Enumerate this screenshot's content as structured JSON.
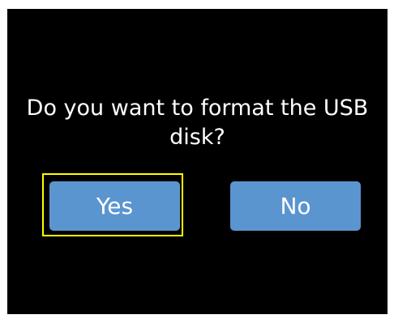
{
  "dialog": {
    "message": "Do you want to format the USB disk?",
    "yes_label": "Yes",
    "no_label": "No",
    "focused_button": "yes"
  },
  "colors": {
    "screen_background": "#000000",
    "button_background": "#5b95cf",
    "button_text": "#ffffff",
    "focus_outline": "#ffff00"
  }
}
